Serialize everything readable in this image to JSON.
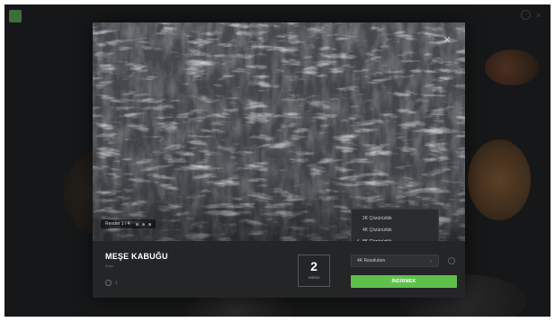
{
  "modal": {
    "title": "MEŞE KABUĞU",
    "subtitle": "Doku",
    "likes": "1",
    "close_icon": "close-icon",
    "render_tag": "Render 1 / 4"
  },
  "counter": {
    "value": "2",
    "label": "KREDİ"
  },
  "resolution_menu": {
    "options": [
      "2K Çözünürlük",
      "4K Çözünürlük",
      "8K Çözünürlük"
    ],
    "selected_index": 2
  },
  "resolution_select": {
    "value": "4K Resolution"
  },
  "download_button": {
    "label": "İNDİRMEK"
  },
  "colors": {
    "accent": "#5fc04b",
    "modal_bg": "#242527",
    "backdrop": "#161718"
  }
}
